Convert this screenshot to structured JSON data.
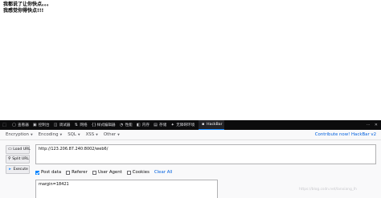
{
  "page": {
    "line1": "我都说了让你快点。。。",
    "line2": "我感觉你得快点!!!"
  },
  "devtools": {
    "tools": [
      {
        "icon": "inspector-icon",
        "glyph": "▢",
        "label": "查看器"
      },
      {
        "icon": "console-icon",
        "glyph": "▣",
        "label": "控制台"
      },
      {
        "icon": "debugger-icon",
        "glyph": "◫",
        "label": "调试器"
      },
      {
        "icon": "network-icon",
        "glyph": "⇅",
        "label": "网络"
      },
      {
        "icon": "style-editor-icon",
        "glyph": "{}",
        "label": "样式编辑器"
      },
      {
        "icon": "performance-icon",
        "glyph": "◔",
        "label": "性能"
      },
      {
        "icon": "memory-icon",
        "glyph": "◧",
        "label": "内存"
      },
      {
        "icon": "storage-icon",
        "glyph": "▤",
        "label": "存储"
      },
      {
        "icon": "accessibility-icon",
        "glyph": "✦",
        "label": "无障碍环境"
      },
      {
        "icon": "hackbar-icon",
        "glyph": "▪",
        "label": "HackBar"
      }
    ],
    "active_index": 9
  },
  "hackbar": {
    "menu": {
      "encryption": "Encryption",
      "encoding": "Encoding",
      "sql": "SQL",
      "xss": "XSS",
      "other": "Other",
      "contribute": "Contribute now! HackBar v2"
    },
    "buttons": {
      "load": "Load URL",
      "split": "Split URL",
      "execute": "Execute"
    },
    "url_value": "http://123.206.87.240:8002/web6/",
    "options": {
      "post_data": {
        "label": "Post data",
        "checked": true
      },
      "referer": {
        "label": "Referer",
        "checked": false
      },
      "user_agent": {
        "label": "User Agent",
        "checked": false
      },
      "cookies": {
        "label": "Cookies",
        "checked": false
      },
      "clear_all": "Clear All"
    },
    "post_value": "margin=18421"
  },
  "watermark": "https://blog.csdn.net/lanxiang_lh"
}
